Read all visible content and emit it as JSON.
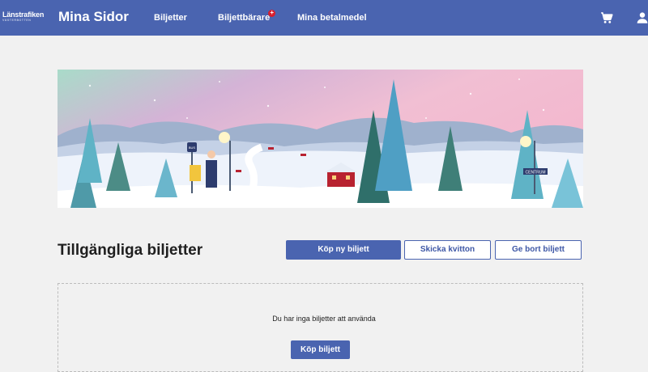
{
  "header": {
    "logo_main": "Länstrafiken",
    "logo_sub": "VÄSTERBOTTEN",
    "site_title": "Mina Sidor",
    "nav": [
      {
        "label": "Biljetter"
      },
      {
        "label": "Biljettbärare",
        "badge": "+"
      },
      {
        "label": "Mina betalmedel"
      }
    ],
    "cart_icon": "shopping-cart-icon",
    "user_icon": "user-icon"
  },
  "banner": {
    "bus_stop_sign": "BUS",
    "centrum_sign": "CENTRUM"
  },
  "tickets": {
    "title": "Tillgängliga biljetter",
    "buy_new_label": "Köp ny biljett",
    "send_receipt_label": "Skicka kvitton",
    "give_away_label": "Ge bort biljett",
    "empty_message": "Du har inga biljetter att använda",
    "buy_label": "Köp biljett"
  },
  "colors": {
    "brand_blue": "#4a64b0",
    "badge_red": "#d81e2c",
    "page_background": "#f1f1f1"
  }
}
